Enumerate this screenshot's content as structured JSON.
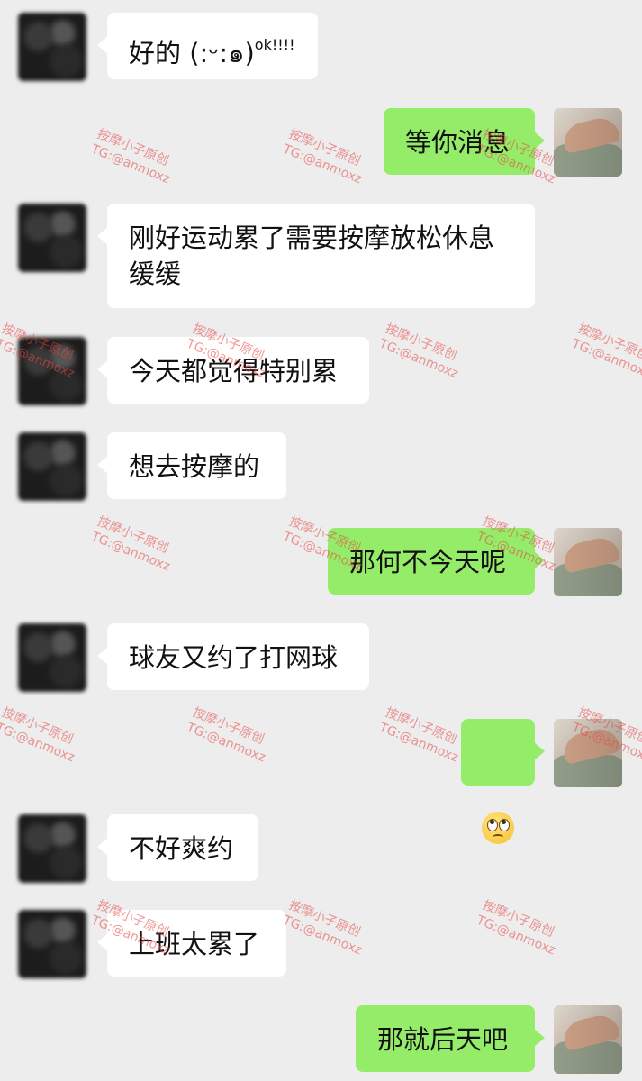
{
  "messages": [
    {
      "side": "in",
      "text": "好的 (:ᵕ:๑)",
      "sup": "ok!!!!"
    },
    {
      "side": "out",
      "text": "等你消息"
    },
    {
      "side": "in",
      "text": "刚好运动累了需要按摩放松休息\n缓缓"
    },
    {
      "side": "in",
      "text": "今天都觉得特别累"
    },
    {
      "side": "in",
      "text": "想去按摩的"
    },
    {
      "side": "out",
      "text": "那何不今天呢"
    },
    {
      "side": "in",
      "text": "球友又约了打网球"
    },
    {
      "side": "out",
      "text": "",
      "emoji": "face-with-rolling-eyes-emoji"
    },
    {
      "side": "in",
      "text": "不好爽约"
    },
    {
      "side": "in",
      "text": "上班太累了"
    },
    {
      "side": "out",
      "text": "那就后天吧"
    }
  ],
  "watermark": {
    "line1": "按摩小子原创",
    "line2": "TG:@anmoxz"
  },
  "colors": {
    "background": "#ededed",
    "incoming": "#ffffff",
    "outgoing": "#95ec69",
    "watermark": "#e84646"
  }
}
